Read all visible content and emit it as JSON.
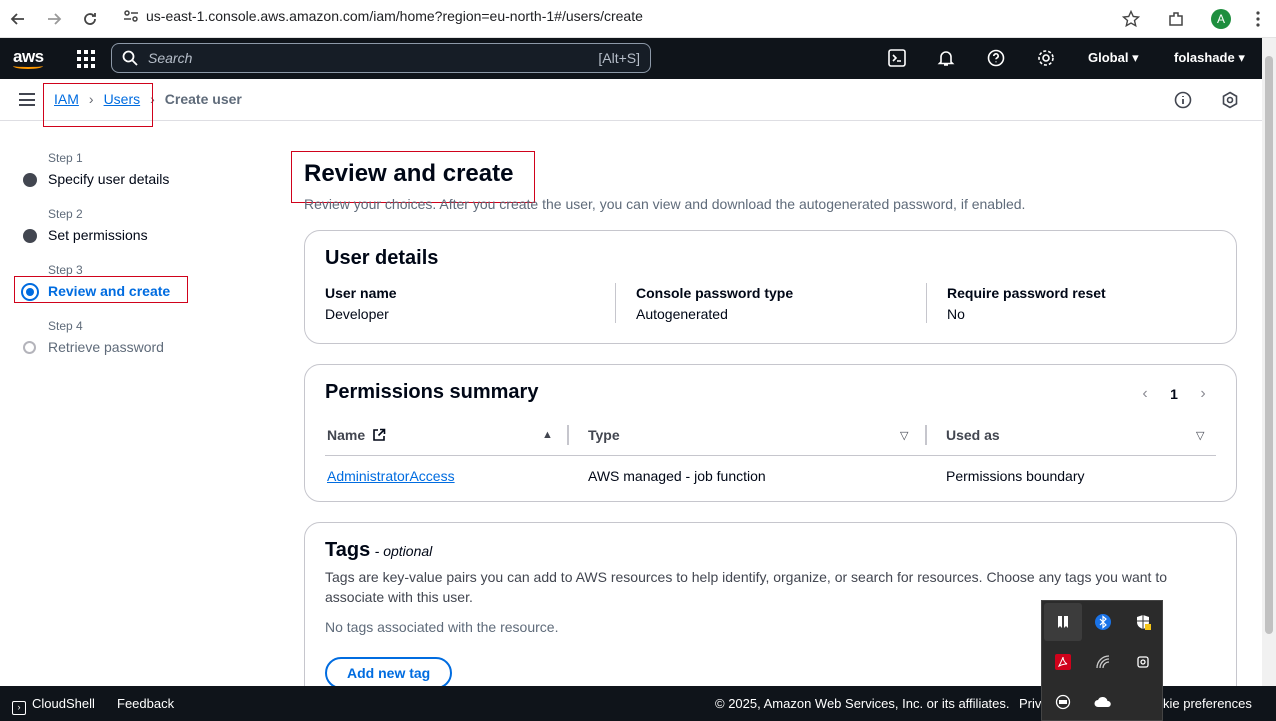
{
  "browser": {
    "url": "us-east-1.console.aws.amazon.com/iam/home?region=eu-north-1#/users/create",
    "profile_initial": "A"
  },
  "aws_nav": {
    "logo": "aws",
    "search_placeholder": "Search",
    "search_shortcut": "[Alt+S]",
    "region": "Global",
    "account": "folashade"
  },
  "breadcrumb": {
    "items": [
      "IAM",
      "Users"
    ],
    "current": "Create user"
  },
  "steps": [
    {
      "label": "Step 1",
      "title": "Specify user details",
      "state": "done"
    },
    {
      "label": "Step 2",
      "title": "Set permissions",
      "state": "done"
    },
    {
      "label": "Step 3",
      "title": "Review and create",
      "state": "active"
    },
    {
      "label": "Step 4",
      "title": "Retrieve password",
      "state": "pending"
    }
  ],
  "main": {
    "title": "Review and create",
    "description": "Review your choices. After you create the user, you can view and download the autogenerated password, if enabled."
  },
  "user_details": {
    "heading": "User details",
    "fields": [
      {
        "key": "User name",
        "value": "Developer"
      },
      {
        "key": "Console password type",
        "value": "Autogenerated"
      },
      {
        "key": "Require password reset",
        "value": "No"
      }
    ]
  },
  "permissions": {
    "heading": "Permissions summary",
    "page": "1",
    "columns": [
      "Name",
      "Type",
      "Used as"
    ],
    "rows": [
      {
        "name": "AdministratorAccess",
        "type": "AWS managed - job function",
        "used_as": "Permissions boundary"
      }
    ]
  },
  "tags": {
    "heading": "Tags",
    "optional": "- optional",
    "description": "Tags are key-value pairs you can add to AWS resources to help identify, organize, or search for resources. Choose any tags you want to associate with this user.",
    "empty": "No tags associated with the resource.",
    "add_button": "Add new tag"
  },
  "footer": {
    "cloudshell": "CloudShell",
    "feedback": "Feedback",
    "copyright": "© 2025, Amazon Web Services, Inc. or its affiliates.",
    "privacy": "Priv",
    "cookie": "kie preferences"
  },
  "colors": {
    "accent": "#006ce0",
    "nav_bg": "#0f141a",
    "annotation_red": "#d0021b"
  }
}
